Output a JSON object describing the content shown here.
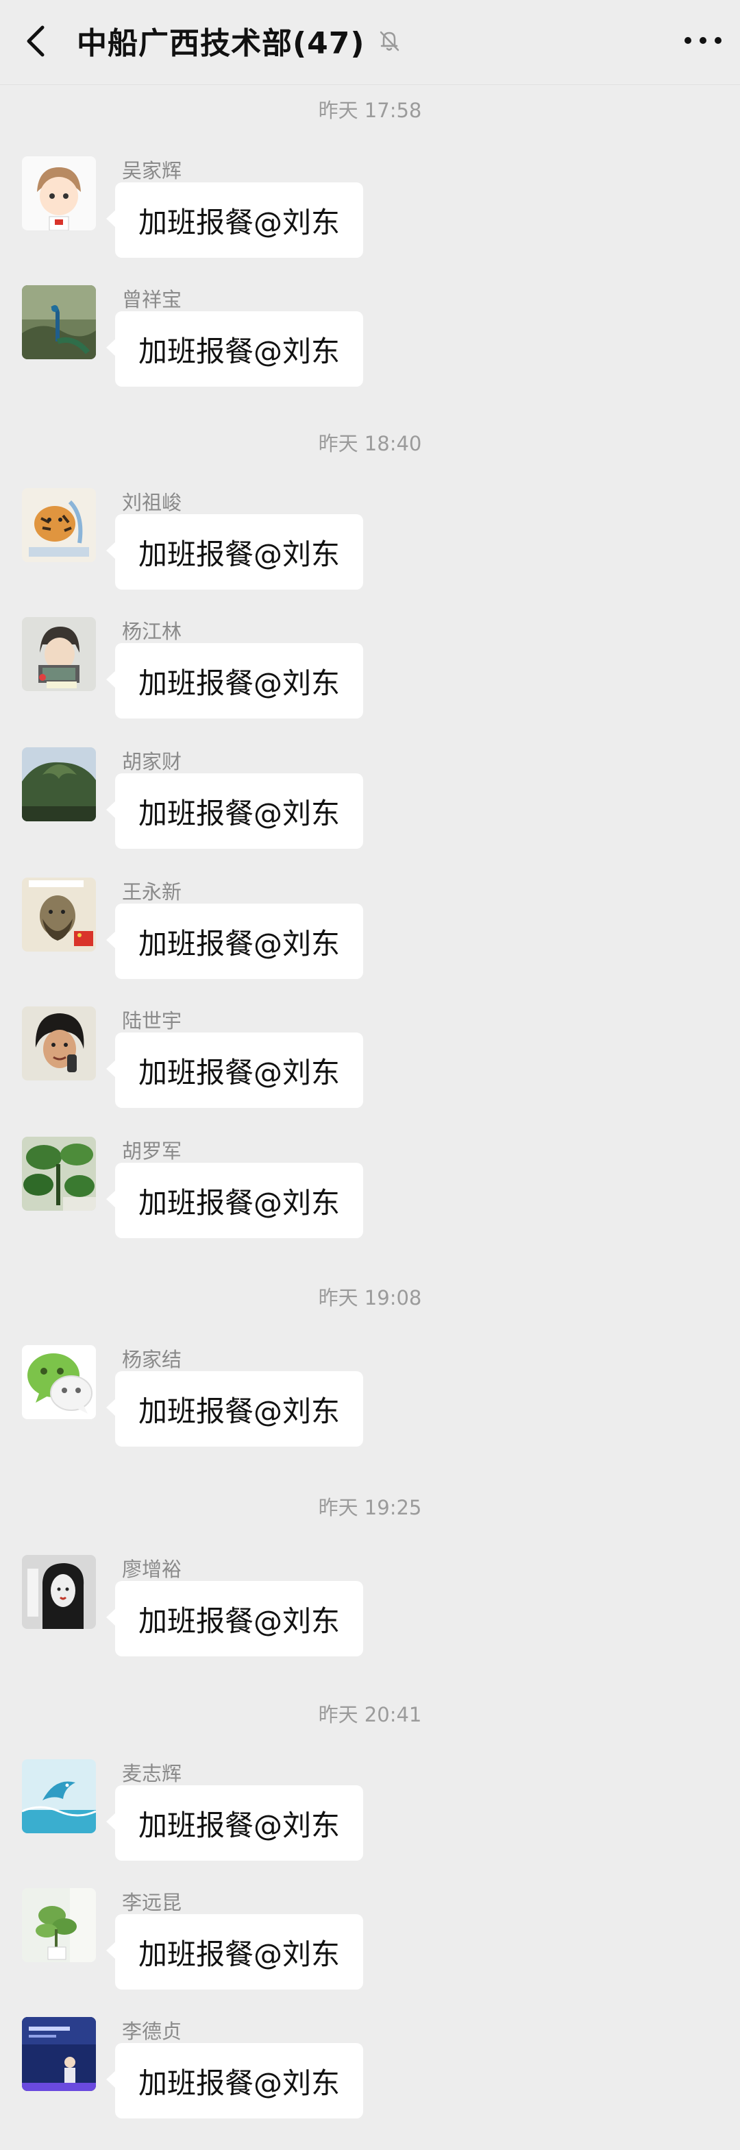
{
  "header": {
    "title": "中船广西技术部(47)"
  },
  "times": [
    "昨天 17:58",
    "昨天 18:40",
    "昨天 19:08",
    "昨天 19:25",
    "昨天 20:41"
  ],
  "messages": [
    {
      "sender": "吴家辉",
      "text": "加班报餐@刘东"
    },
    {
      "sender": "曾祥宝",
      "text": "加班报餐@刘东"
    },
    {
      "sender": "刘祖峻",
      "text": "加班报餐@刘东"
    },
    {
      "sender": "杨江林",
      "text": "加班报餐@刘东"
    },
    {
      "sender": "胡家财",
      "text": "加班报餐@刘东"
    },
    {
      "sender": "王永新",
      "text": "加班报餐@刘东"
    },
    {
      "sender": "陆世宇",
      "text": "加班报餐@刘东"
    },
    {
      "sender": "胡罗军",
      "text": "加班报餐@刘东"
    },
    {
      "sender": "杨家结",
      "text": "加班报餐@刘东"
    },
    {
      "sender": "廖增裕",
      "text": "加班报餐@刘东"
    },
    {
      "sender": "麦志辉",
      "text": "加班报餐@刘东"
    },
    {
      "sender": "李远昆",
      "text": "加班报餐@刘东"
    },
    {
      "sender": "李德贞",
      "text": "加班报餐@刘东"
    }
  ],
  "colors": {
    "background": "#ededed",
    "bubble": "#ffffff",
    "meta_text": "#9b9b9b"
  },
  "icons": {
    "back": "chevron-left-icon",
    "mute": "bell-muted-icon",
    "more": "more-dots-icon"
  }
}
